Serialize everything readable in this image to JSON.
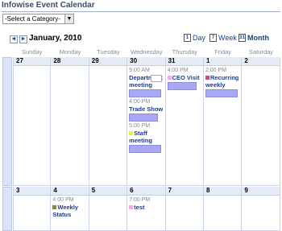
{
  "title": "Infowise Event Calendar",
  "category_select": {
    "value": "-Select a Category-"
  },
  "nav": {
    "prev": "◄",
    "next": "►",
    "month_label": "January, 2010"
  },
  "views": {
    "day": "Day",
    "week": "Week",
    "month": "Month",
    "day_icon": "1",
    "week_icon": "7",
    "month_icon": "31"
  },
  "dow": [
    "Sunday",
    "Monday",
    "Tuesday",
    "Wednesday",
    "Thursday",
    "Friday",
    "Saturday"
  ],
  "weeks": [
    {
      "days": [
        {
          "num": "27",
          "events": []
        },
        {
          "num": "28",
          "events": []
        },
        {
          "num": "29",
          "events": []
        },
        {
          "num": "30",
          "events": [
            {
              "time": "9:00 AM",
              "title": "Department meeting",
              "dot": ""
            },
            {
              "time": "4:00 PM",
              "title": "Trade Show",
              "dot": ""
            },
            {
              "time": "5:00 PM",
              "title": "Staff meeting",
              "dot": "#e8f040"
            }
          ]
        },
        {
          "num": "31",
          "events": [
            {
              "time": "4:00 PM",
              "title": "CEO Visit",
              "dot": "#f0a8e8"
            }
          ]
        },
        {
          "num": "1",
          "events": [
            {
              "time": "2:00 PM",
              "title": "Recurring weekly",
              "dot": "#d04878"
            }
          ]
        },
        {
          "num": "2",
          "events": []
        }
      ]
    },
    {
      "days": [
        {
          "num": "3",
          "events": []
        },
        {
          "num": "4",
          "events": [
            {
              "time": "4:00 PM",
              "title": "Weekly Status",
              "dot": "#8a8a20"
            }
          ]
        },
        {
          "num": "5",
          "events": []
        },
        {
          "num": "6",
          "events": [
            {
              "time": "7:00 PM",
              "title": "test",
              "dot": "#f0a8e8"
            }
          ]
        },
        {
          "num": "7",
          "events": []
        },
        {
          "num": "8",
          "events": []
        },
        {
          "num": "9",
          "events": []
        }
      ]
    }
  ]
}
